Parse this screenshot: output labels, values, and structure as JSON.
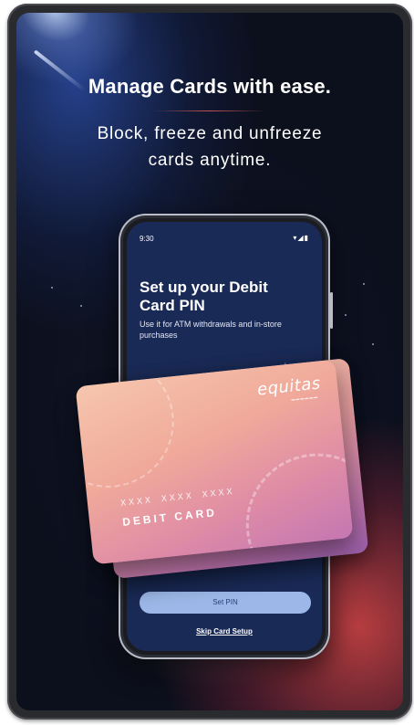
{
  "promo": {
    "title": "Manage Cards with ease.",
    "subtitle_line1": "Block, freeze and unfreeze",
    "subtitle_line2": "cards anytime."
  },
  "phone": {
    "status_time": "9:30",
    "status_icons": "▾◢▮",
    "heading_line1": "Set up your Debit",
    "heading_line2": "Card PIN",
    "description": "Use it for ATM withdrawals and in-store purchases",
    "primary_button": "Set PIN",
    "skip_link": "Skip Card Setup"
  },
  "card": {
    "brand": "equitas",
    "number_mask": "XXXX XXXX XXXX",
    "type": "DEBIT CARD"
  },
  "colors": {
    "background": "#0b0d18",
    "accent_red": "#d64646",
    "phone_screen": "#1a2a56",
    "button": "#9db8e8"
  }
}
